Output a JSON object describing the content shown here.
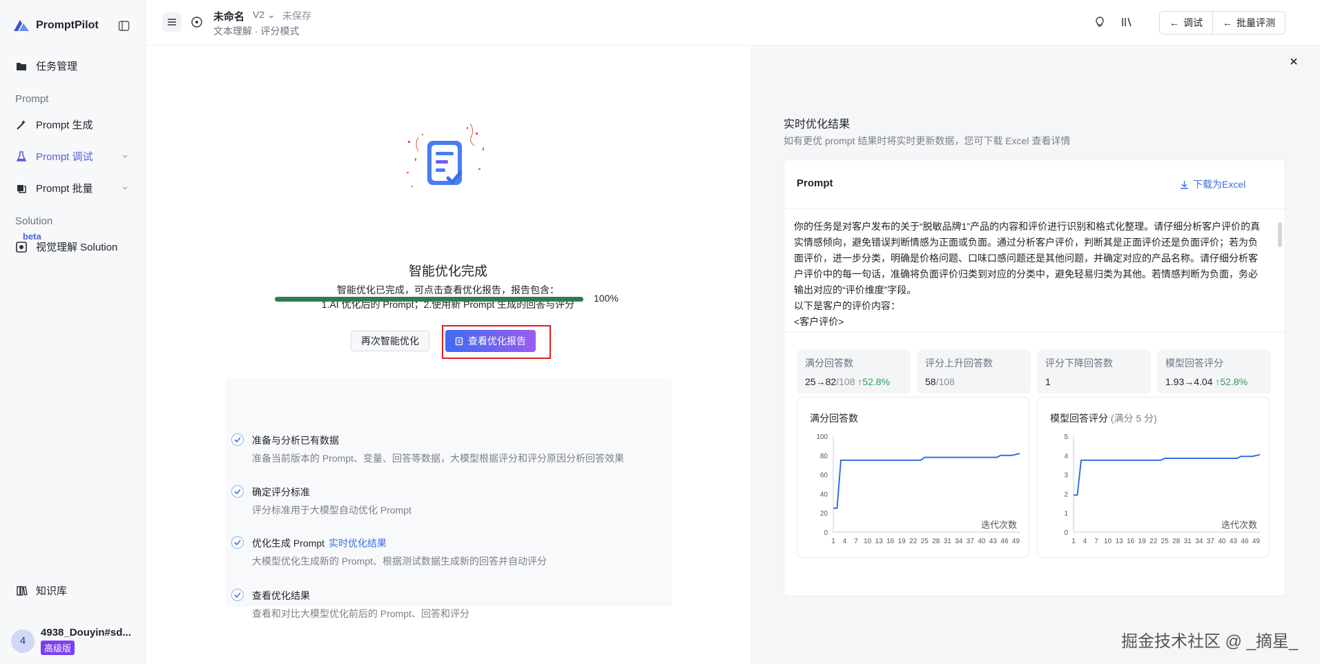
{
  "sidebar": {
    "brand": "PromptPilot",
    "items": [
      {
        "label": "任务管理",
        "icon": "folder-icon"
      },
      {
        "label": "Prompt 生成",
        "icon": "wand-icon"
      },
      {
        "label": "Prompt 调试",
        "icon": "flask-icon"
      },
      {
        "label": "Prompt 批量",
        "icon": "batch-icon"
      },
      {
        "label": "视觉理解 Solution",
        "icon": "vision-icon"
      },
      {
        "label": "知识库",
        "icon": "book-icon"
      }
    ],
    "sections": [
      "Prompt",
      "Solution"
    ],
    "beta": "beta",
    "user": {
      "initial": "4",
      "name": "4938_Douyin#sd...",
      "badge": "高级版"
    }
  },
  "header": {
    "title": "未命名",
    "version": "V2",
    "status": "未保存",
    "subtitle": "文本理解 · 评分模式",
    "debug_btn": "调试",
    "batch_btn": "批量评测"
  },
  "main": {
    "done_title": "智能优化完成",
    "done_desc_1": "智能优化已完成，可点击查看优化报告，报告包含：",
    "done_desc_2": "1.AI 优化后的 Prompt；2.使用新 Prompt 生成的回答与评分",
    "progress": 1.0,
    "progress_label": "100%",
    "btn_again": "再次智能优化",
    "btn_report": "查看优化报告",
    "steps": [
      {
        "title": "准备与分析已有数据",
        "desc": "准备当前版本的 Prompt、变量、回答等数据，大模型根据评分和评分原因分析回答效果"
      },
      {
        "title": "确定评分标准",
        "desc": "评分标准用于大模型自动优化 Prompt"
      },
      {
        "title": "优化生成 Prompt",
        "link": "实时优化结果",
        "desc": "大模型优化生成新的 Prompt、根据测试数据生成新的回答并自动评分"
      },
      {
        "title": "查看优化结果",
        "desc": "查看和对比大模型优化前后的 Prompt、回答和评分"
      }
    ]
  },
  "right": {
    "title": "实时优化结果",
    "subtitle": "如有更优 prompt 结果时将实时更新数据，您可下载 Excel 查看详情",
    "card_title": "Prompt",
    "download": "下载为Excel",
    "prompt_text": "你的任务是对客户发布的关于“脱敏品牌1”产品的内容和评价进行识别和格式化整理。请仔细分析客户评价的真实情感倾向，避免错误判断情感为正面或负面。通过分析客户评价，判断其是正面评价还是负面评价；若为负面评价，进一步分类，明确是价格问题、口味口感问题还是其他问题，并确定对应的产品名称。请仔细分析客户评价中的每一句话，准确将负面评价归类到对应的分类中，避免轻易归类为其他。若情感判断为负面，务必输出对应的“评价维度”字段。\n以下是客户的评价内容：\n<客户评价>\n{{CUSTOMER_REVIEWS}}\n</客户评价>",
    "stats": [
      {
        "label": "满分回答数",
        "from": "25",
        "to": "82",
        "total": "/108",
        "change": "↑52.8%"
      },
      {
        "label": "评分上升回答数",
        "from": "",
        "to": "58",
        "total": "/108",
        "change": ""
      },
      {
        "label": "评分下降回答数",
        "from": "",
        "to": "1",
        "total": "",
        "change": ""
      },
      {
        "label": "模型回答评分",
        "from": "1.93",
        "to": "4.04",
        "total": "",
        "change": "↑52.8%"
      }
    ],
    "chart1_title": "满分回答数",
    "chart2_title": "模型回答评分",
    "chart2_note": "(满分 5 分)",
    "watermark": "掘金技术社区 @ _摘星_"
  },
  "chart_data": [
    {
      "type": "line",
      "title": "满分回答数",
      "xlabel": "迭代次数",
      "ylabel": "",
      "ylim": [
        0,
        100
      ],
      "yticks": [
        0,
        20,
        40,
        60,
        80,
        100
      ],
      "xticks": [
        1,
        4,
        7,
        10,
        13,
        16,
        19,
        22,
        25,
        28,
        31,
        34,
        37,
        40,
        43,
        46,
        49
      ],
      "x": [
        1,
        2,
        3,
        10,
        20,
        24,
        25,
        30,
        40,
        44,
        45,
        48,
        50
      ],
      "values": [
        25,
        25,
        75,
        75,
        75,
        75,
        78,
        78,
        78,
        78,
        80,
        80,
        82
      ],
      "color": "#2f6fe4"
    },
    {
      "type": "line",
      "title": "模型回答评分",
      "xlabel": "迭代次数",
      "ylabel": "",
      "ylim": [
        0,
        5
      ],
      "yticks": [
        0,
        1,
        2,
        3,
        4,
        5
      ],
      "xticks": [
        1,
        4,
        7,
        10,
        13,
        16,
        19,
        22,
        25,
        28,
        31,
        34,
        37,
        40,
        43,
        46,
        49
      ],
      "x": [
        1,
        2,
        3,
        10,
        20,
        24,
        25,
        30,
        40,
        44,
        45,
        48,
        50
      ],
      "values": [
        1.93,
        1.93,
        3.75,
        3.75,
        3.75,
        3.75,
        3.85,
        3.85,
        3.85,
        3.85,
        3.95,
        3.95,
        4.04
      ],
      "color": "#2f6fe4"
    }
  ]
}
